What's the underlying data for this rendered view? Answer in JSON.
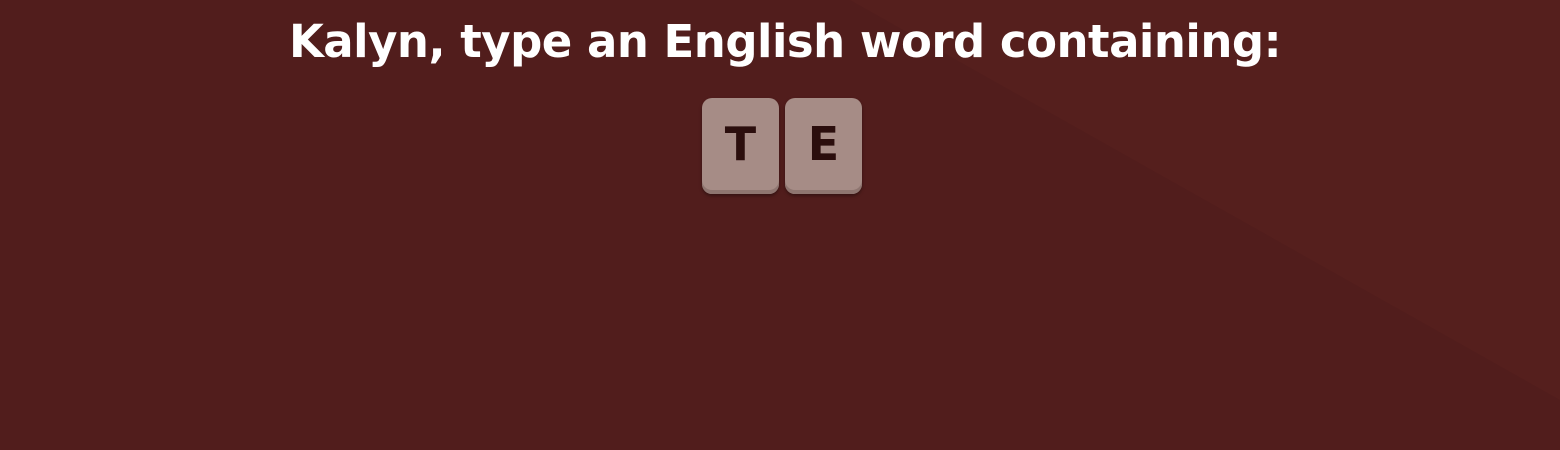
{
  "prompt": {
    "text": "Kalyn, type an English word containing:"
  },
  "syllable": {
    "letters": [
      "T",
      "E"
    ]
  },
  "colors": {
    "background": "#511d1c",
    "prompt_text": "#ffffff",
    "tile_background": "#a68c86",
    "tile_text": "#2b0e0d"
  }
}
